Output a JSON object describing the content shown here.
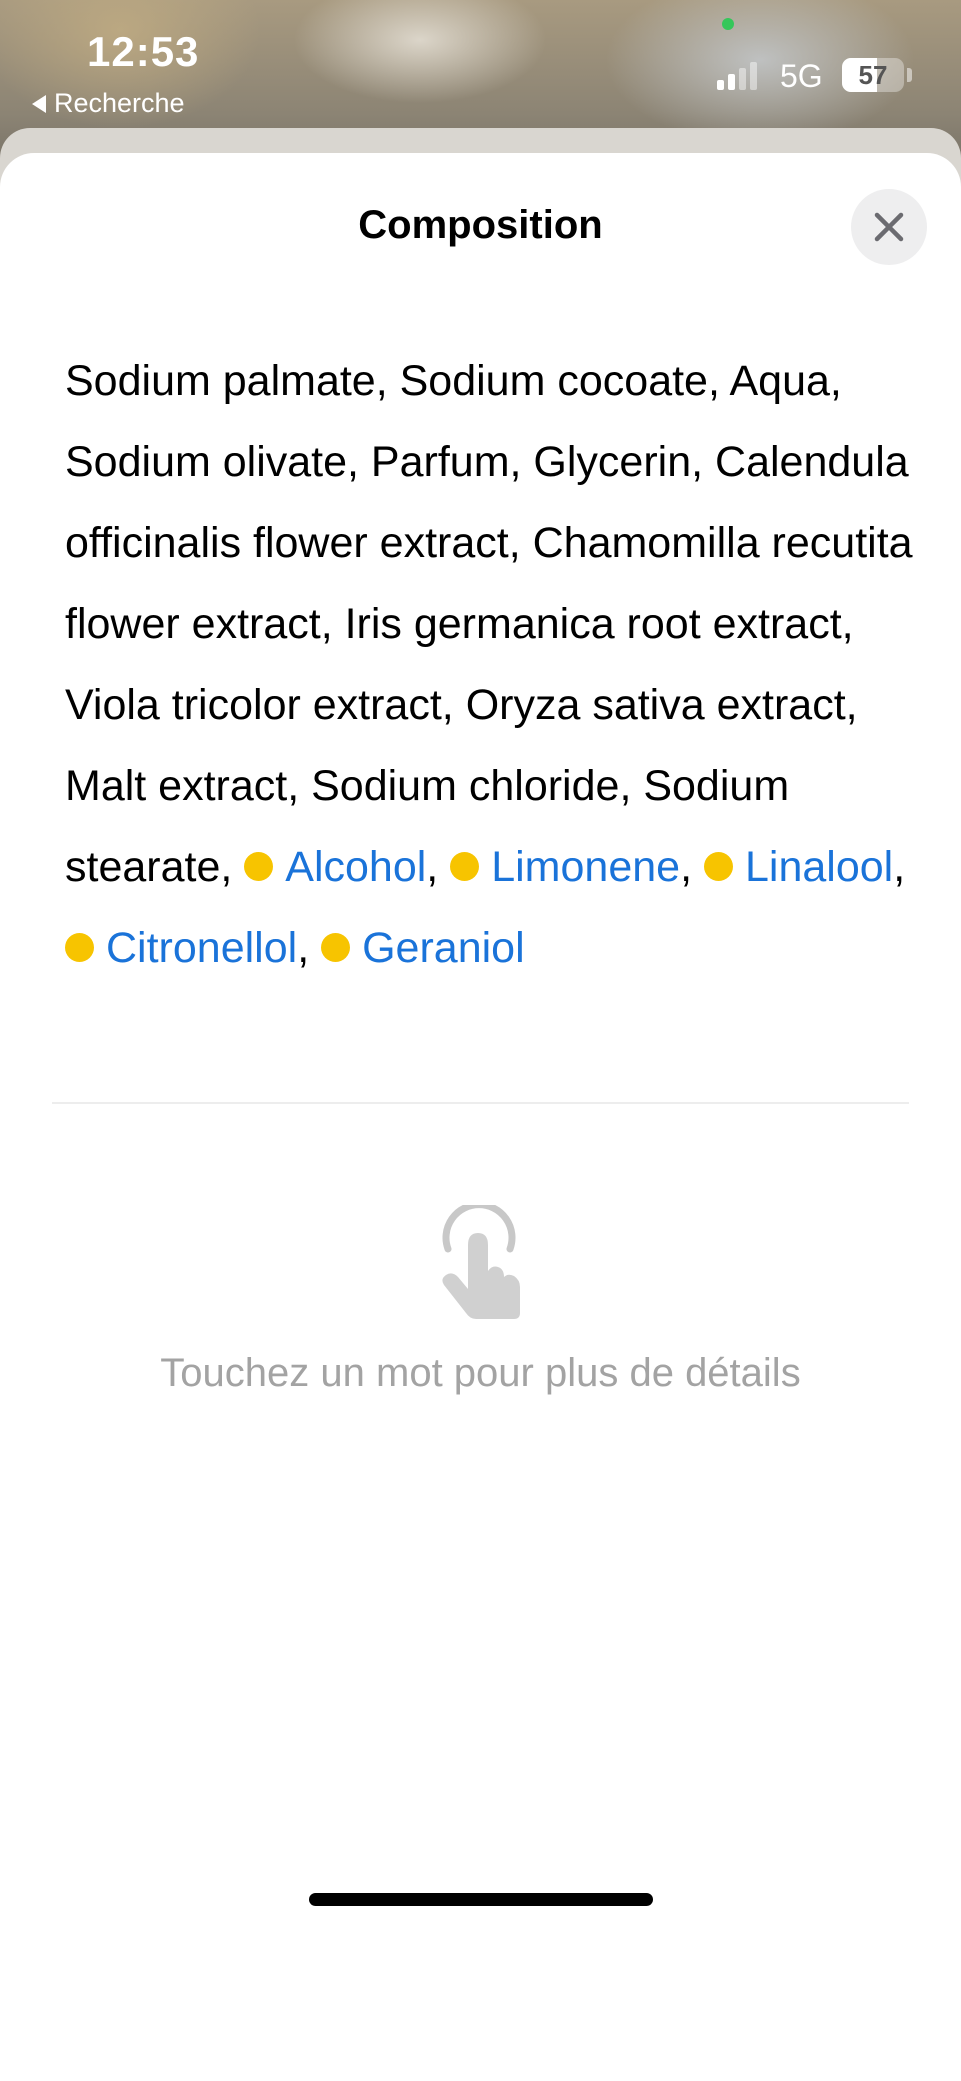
{
  "status_bar": {
    "time": "12:53",
    "back_label": "Recherche",
    "network": "5G",
    "battery_level": "57",
    "battery_percent": 57
  },
  "sheet": {
    "title": "Composition",
    "close_icon": "close-icon",
    "ingredients_plain": "Sodium palmate, Sodium cocoate, Aqua, Sodium olivate, Parfum, Glycerin, Calendula officinalis flower extract, Chamomilla recutita flower extract, Iris germanica root extract, Viola tricolor extract, Oryza sativa extract, Malt extract, Sodium chloride, Sodium stearate, ",
    "flagged_ingredients": [
      "Alcohol",
      "Limonene",
      "Linalool",
      "Citronellol",
      "Geraniol"
    ],
    "flag_color": "#f7c400",
    "link_color": "#1a73d9",
    "hint_icon": "tap-hand-icon",
    "hint_text": "Touchez un mot pour plus de détails"
  }
}
